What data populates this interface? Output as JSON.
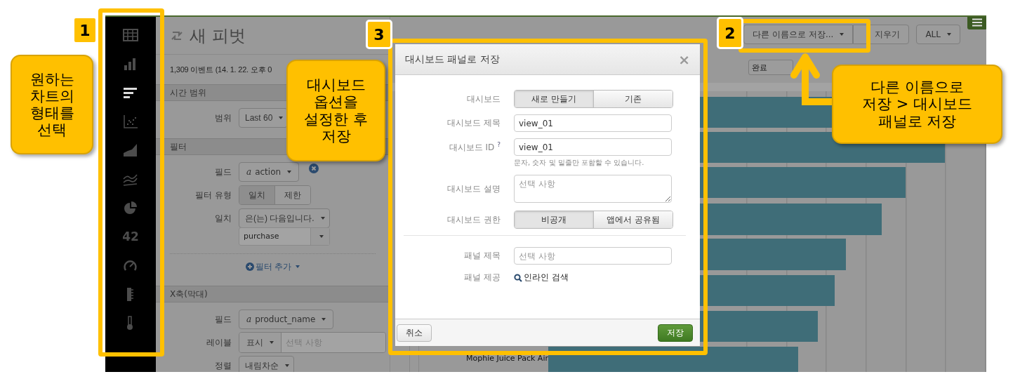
{
  "app": {
    "sidebar": {
      "items": [
        {
          "kind": "table",
          "selected": false
        },
        {
          "kind": "column",
          "selected": false
        },
        {
          "kind": "bar",
          "selected": true
        },
        {
          "kind": "scatter",
          "selected": false
        },
        {
          "kind": "area",
          "selected": false
        },
        {
          "kind": "line",
          "selected": false
        },
        {
          "kind": "pie",
          "selected": false
        },
        {
          "kind": "number",
          "label": "42",
          "selected": false
        },
        {
          "kind": "gauge",
          "selected": false
        },
        {
          "kind": "filler",
          "selected": false
        },
        {
          "kind": "marker",
          "selected": false
        }
      ]
    },
    "title": "새 피벗",
    "events": "1,309 이벤트 (14. 1. 22. 오후 0",
    "sections": [
      {
        "header": "시간 범위",
        "rows": [
          {
            "kind": "dropdown",
            "label": "범위",
            "text": "Last 60"
          }
        ]
      },
      {
        "header": "필터",
        "rows": [
          {
            "kind": "field",
            "label": "필드",
            "type_icon": "a",
            "text": "action",
            "removable": true
          },
          {
            "kind": "segmented",
            "label": "필터 유형",
            "options": [
              {
                "label": "일치",
                "selected": true
              },
              {
                "label": "제한",
                "selected": false
              }
            ]
          },
          {
            "kind": "dropdown",
            "label": "일치",
            "text": "은(는) 다음입니다."
          },
          {
            "kind": "combo",
            "value": "purchase"
          },
          {
            "kind": "add",
            "text": "필터 추가"
          }
        ]
      },
      {
        "header": "X축(막대)",
        "rows": [
          {
            "kind": "field",
            "label": "필드",
            "type_icon": "a",
            "text": "product_name",
            "removable": false
          },
          {
            "kind": "label-input",
            "label": "레이블",
            "text": "표시",
            "placeholder": "선택 사항"
          },
          {
            "kind": "dropdown",
            "label": "정렬",
            "text": "내림차순"
          }
        ]
      }
    ],
    "toolbar": {
      "buttons": [
        {
          "kind": "dropdown",
          "text": "다른 이름으로 저장..."
        },
        {
          "kind": "plain",
          "text": "지우기"
        },
        {
          "kind": "dropdown",
          "text": "ALL"
        }
      ]
    },
    "status_field": {
      "value": "완료"
    },
    "chart": {
      "row_label": "Mophie Juice Pack Air"
    }
  },
  "dialog": {
    "title": "대시보드 패널로 저장",
    "close": "×",
    "rows": [
      {
        "kind": "segmented",
        "label": "대시보드",
        "options": [
          {
            "label": "새로 만들기",
            "selected": true
          },
          {
            "label": "기존",
            "selected": false
          }
        ]
      },
      {
        "kind": "input",
        "label": "대시보드 제목",
        "value": "view_01"
      },
      {
        "kind": "input",
        "label": "대시보드 ID",
        "help_mark": "?",
        "value": "view_01"
      },
      {
        "kind": "help",
        "text": "문자, 숫자 및 밑줄만 포함할 수 있습니다."
      },
      {
        "kind": "textarea",
        "label": "대시보드 설명",
        "placeholder": "선택 사항"
      },
      {
        "kind": "segmented",
        "label": "대시보드 권한",
        "options": [
          {
            "label": "비공개",
            "selected": true
          },
          {
            "label": "앱에서 공유됨",
            "selected": false
          }
        ]
      },
      {
        "kind": "divider"
      },
      {
        "kind": "input",
        "label": "패널 제목",
        "placeholder": "선택 사항"
      },
      {
        "kind": "search",
        "label": "패널 제공",
        "text": "인라인 검색"
      }
    ],
    "cancel": "취소",
    "save": "저장"
  },
  "annotations": {
    "badges": [
      "1",
      "3",
      "2"
    ],
    "callouts": [
      "원하는\n차트의\n형태를\n선택",
      "대시보드\n옵션을\n설정한 후\n저장",
      "다른 이름으로\n저장 > 대시보드\n패널로 저장"
    ]
  }
}
